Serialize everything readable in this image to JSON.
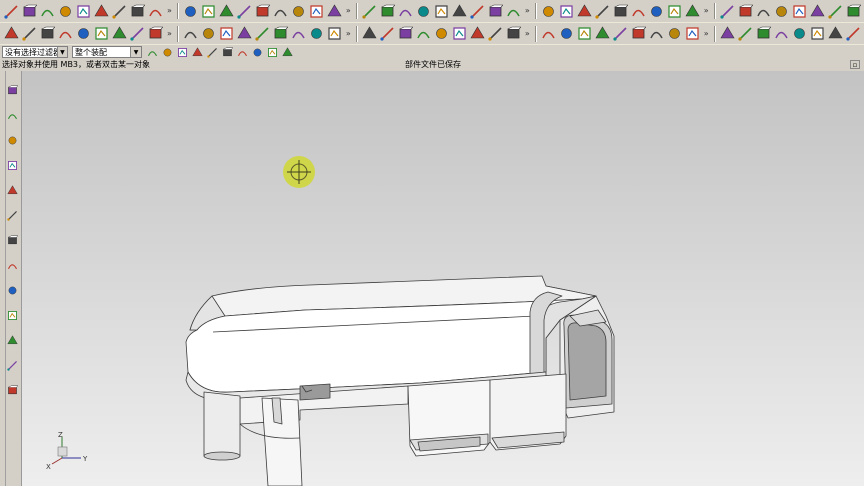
{
  "window": {
    "status_prompt": "选择对象并使用 MB3，或者双击某一对象",
    "status_message": "部件文件已保存"
  },
  "toolbar_row1": {
    "icons": [
      "line-icon",
      "arc-icon",
      "rectangle-icon",
      "studio-spline-icon",
      "text-icon",
      "curve-icon",
      "offset-curve-icon",
      "helix-icon",
      "law-curve-icon",
      "project-curve-icon",
      "combined-curve-icon",
      "extract-curve-icon",
      "isoparametric-icon",
      "section-curve-icon",
      "intersection-curve-icon",
      "mirror-curve-icon",
      "wrap-icon",
      "edit-curve-icon",
      "edit-param-icon",
      "trim-icon",
      "divide-curve-icon",
      "curve-length-icon",
      "smooth-spline-icon",
      "dimension-icon",
      "angle-icon",
      "align-icon",
      "surface-icon",
      "ruled-surface-icon",
      "through-curves-icon",
      "swept-icon",
      "n-sided-icon",
      "bridge-icon",
      "offset-surface-icon",
      "trim-sheet-icon",
      "extension-icon",
      "blend-icon",
      "section-surface-icon",
      "styled-blend-icon",
      "shape-icon",
      "transform-icon",
      "pattern-icon",
      "color-icon",
      "analysis-icon",
      "check-icon",
      "warning-icon",
      "shaded-icon",
      "curvature-icon",
      "reflection-icon",
      "deviation-icon",
      "more-icon"
    ],
    "overflow_label": "»"
  },
  "toolbar_row2": {
    "icons": [
      "sketch-icon",
      "datum-icon",
      "block-icon",
      "cylinder-icon",
      "cone-icon",
      "sphere-icon",
      "extrude-icon",
      "revolve-icon",
      "hole-icon",
      "boss-icon",
      "pocket-icon",
      "pad-icon",
      "slot-icon",
      "groove-icon",
      "unite-icon",
      "subtract-icon",
      "intersect-icon",
      "edge-blend-icon",
      "chamfer-icon",
      "shell-icon",
      "draft-icon",
      "offset-face-icon",
      "scale-body-icon",
      "thicken-icon",
      "split-body-icon",
      "trim-body-icon",
      "instance-icon",
      "mirror-body-icon",
      "replace-face-icon",
      "move-face-icon",
      "delete-face-icon",
      "flange-icon",
      "bend-icon",
      "jog-icon",
      "tab-icon",
      "corner-icon",
      "snap-icon",
      "measure-icon",
      "property-icon",
      "layer-icon",
      "render-icon",
      "view-icon",
      "orient-icon",
      "zoom-icon",
      "pan-icon",
      "rotate-icon",
      "fit-icon",
      "shade-icon",
      "wireframe-icon",
      "more-icon"
    ],
    "overflow_label": "»"
  },
  "toolbar_row3": {
    "type_filter": "没有选择过滤器",
    "scope_filter": "整个装配",
    "snap_icons": [
      "endpoint-icon",
      "midpoint-icon",
      "control-point-icon",
      "intersection-icon",
      "center-icon",
      "quadrant-icon",
      "point-on-curve-icon",
      "existing-point-icon",
      "on-surface-icon",
      "bounded-grid-icon"
    ]
  },
  "resource_bar": {
    "icons": [
      "assembly-navigator-icon",
      "constraint-navigator-icon",
      "part-navigator-icon",
      "reuse-library-icon",
      "internet-explorer-icon",
      "history-icon",
      "system-materials-icon",
      "process-studio-icon",
      "manufacturing-wizard-icon",
      "roles-icon",
      "system-scene-icon",
      "measure-icon",
      "visualization-icon"
    ]
  },
  "viewport": {
    "background_top": "#c3c3c3",
    "background_bottom": "#eeeeee",
    "cursor_color": "#cfd64a",
    "triad": {
      "x_label": "X",
      "y_label": "Y",
      "z_label": "Z"
    }
  }
}
